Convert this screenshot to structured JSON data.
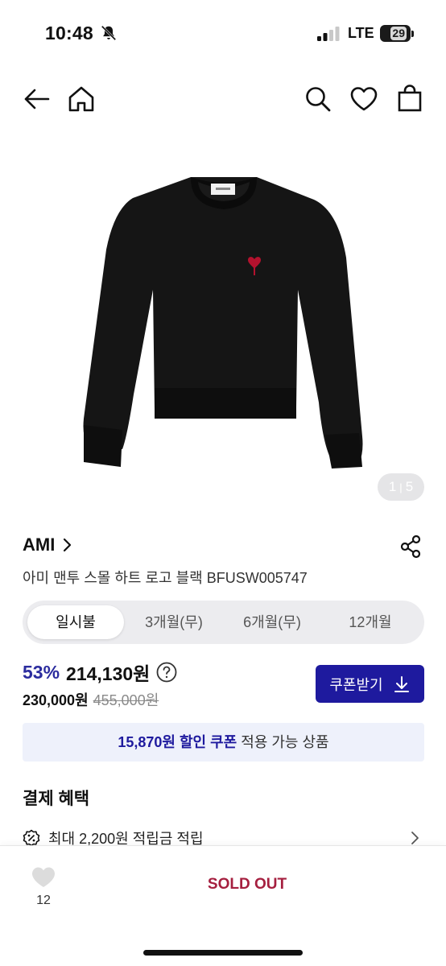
{
  "status_bar": {
    "time": "10:48",
    "network": "LTE",
    "battery": "29"
  },
  "header": {
    "icons": [
      "back-arrow-icon",
      "home-icon",
      "search-icon",
      "heart-icon",
      "shopping-bag-icon"
    ]
  },
  "gallery": {
    "current": "1",
    "total": "5"
  },
  "product": {
    "brand": "AMI",
    "title": "아미 맨투 스몰 하트 로고 블랙 BFUSW005747"
  },
  "payment_tabs": [
    {
      "label": "일시불",
      "active": true
    },
    {
      "label": "3개월(무)",
      "active": false
    },
    {
      "label": "6개월(무)",
      "active": false
    },
    {
      "label": "12개월",
      "active": false
    }
  ],
  "price": {
    "discount_rate": "53%",
    "sale_price": "214,130원",
    "base_price": "230,000원",
    "original_price": "455,000원"
  },
  "coupon_button": {
    "label": "쿠폰받기"
  },
  "coupon_banner": {
    "highlight": "15,870원 할인 쿠폰",
    "rest": " 적용 가능 상품"
  },
  "benefits": {
    "title": "결제 혜택",
    "item": "최대 2,200원 적립금 적립"
  },
  "bottom_bar": {
    "wish_count": "12",
    "sold_out_label": "SOLD OUT"
  },
  "colors": {
    "accent": "#1e1a9e",
    "discount": "#2b2c9e",
    "sold_out": "#a51f3f",
    "banner_bg": "#eef1fb"
  }
}
